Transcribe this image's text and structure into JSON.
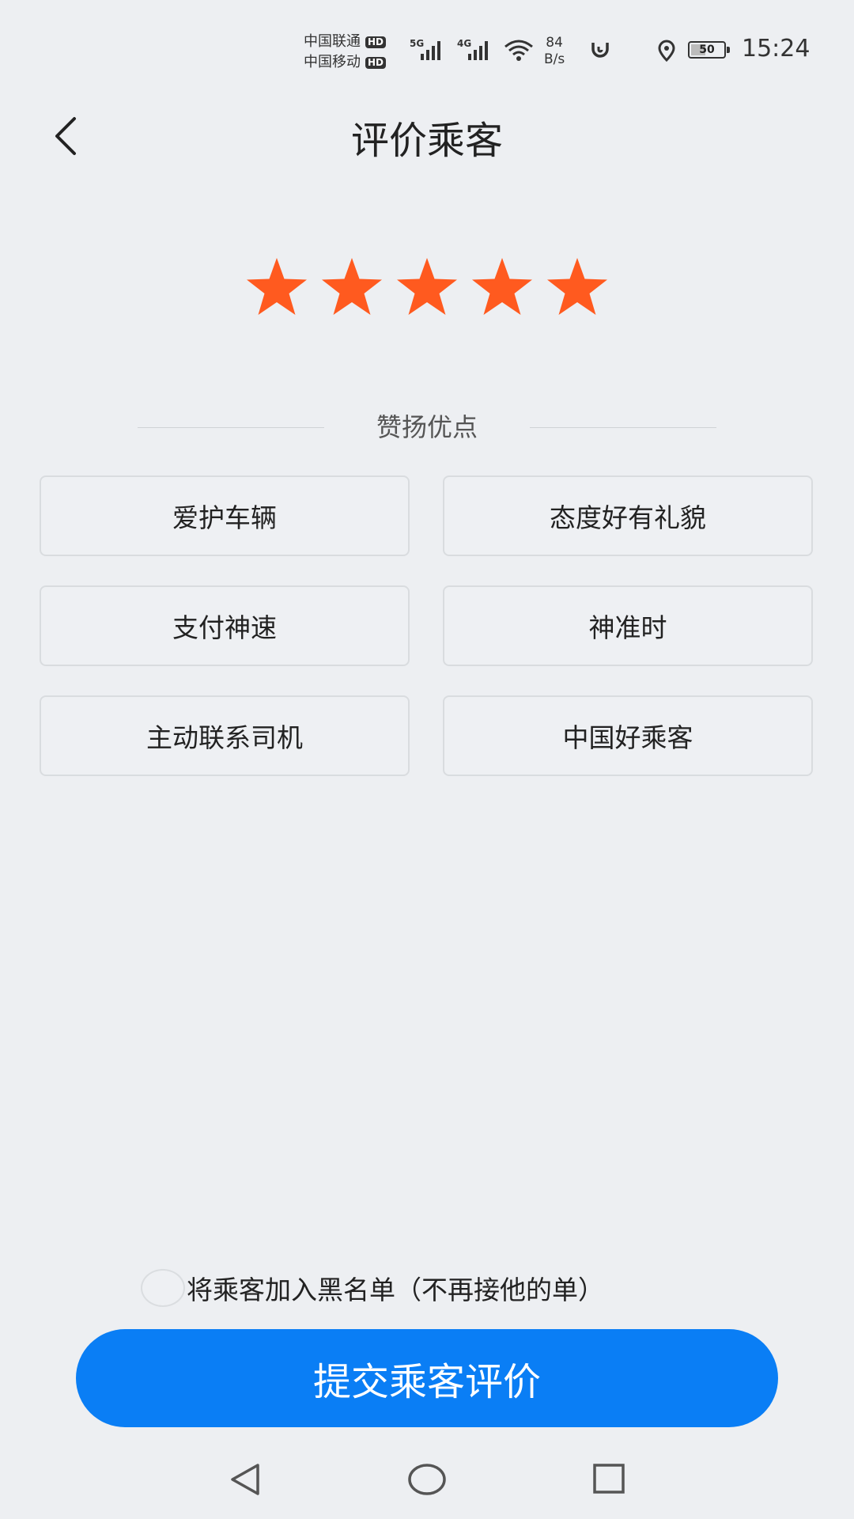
{
  "status_bar": {
    "carriers": [
      {
        "name": "中国联通",
        "badge": "HD"
      },
      {
        "name": "中国移动",
        "badge": "HD"
      }
    ],
    "network_types": [
      "5G",
      "4G"
    ],
    "speed_value": "84",
    "speed_unit": "B/s",
    "battery_level": "50",
    "battery_fraction": 0.5,
    "time": "15:24"
  },
  "header": {
    "title": "评价乘客",
    "back_icon": "chevron-left-icon"
  },
  "rating": {
    "value": 5,
    "max": 5,
    "star_color": "#ff5a1f"
  },
  "praise": {
    "section_label": "赞扬优点",
    "tags": [
      "爱护车辆",
      "态度好有礼貌",
      "支付神速",
      "神准时",
      "主动联系司机",
      "中国好乘客"
    ]
  },
  "blacklist": {
    "label": "将乘客加入黑名单（不再接他的单）",
    "checked": false
  },
  "submit": {
    "label": "提交乘客评价",
    "color": "#0a7ef5"
  },
  "nav_bar": {
    "icons": [
      "back-triangle-icon",
      "home-circle-icon",
      "recents-square-icon"
    ]
  }
}
